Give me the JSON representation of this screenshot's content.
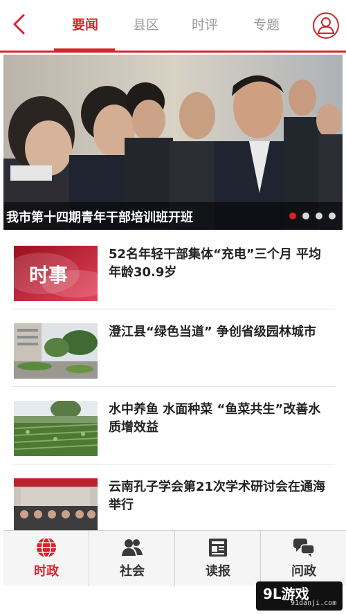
{
  "header": {
    "tabs": [
      {
        "label": "要闻",
        "active": true
      },
      {
        "label": "县区",
        "active": false
      },
      {
        "label": "时评",
        "active": false
      },
      {
        "label": "专题",
        "active": false
      }
    ],
    "back_icon": "chevron-left-icon",
    "user_icon": "user-icon",
    "accent_color": "#d9232a"
  },
  "hero": {
    "title": "我市第十四期青年干部培训班开班",
    "slide_count": 4,
    "active_slide": 1
  },
  "news": [
    {
      "title": "52名年轻干部集体“充电”三个月 平均年龄30.9岁",
      "thumb_text": "时事"
    },
    {
      "title": "澄江县“绿色当道” 争创省级园林城市"
    },
    {
      "title": "水中养鱼 水面种菜 “鱼菜共生”改善水质增效益"
    },
    {
      "title": "云南孔子学会第21次学术研讨会在通海举行"
    }
  ],
  "bottom_nav": [
    {
      "label": "时政",
      "icon": "globe-icon",
      "active": true
    },
    {
      "label": "社会",
      "icon": "people-icon",
      "active": false
    },
    {
      "label": "读报",
      "icon": "newspaper-icon",
      "active": false
    },
    {
      "label": "问政",
      "icon": "chat-bubbles-icon",
      "active": false
    }
  ],
  "watermark": {
    "main": "9L游戏",
    "sub": "91danji.com"
  }
}
